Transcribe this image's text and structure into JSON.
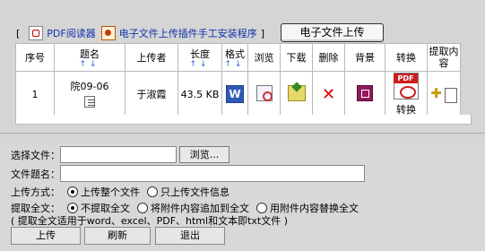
{
  "toolbar": {
    "bracket_open": "[",
    "pdf_reader_link": "PDF阅读器",
    "plugin_link": "电子文件上传插件手工安装程序",
    "bracket_close": "]",
    "upload_button": "电子文件上传"
  },
  "table": {
    "headers": [
      "序号",
      "题名",
      "上传者",
      "长度",
      "格式",
      "浏览",
      "下载",
      "删除",
      "背景",
      "转换",
      "提取内容"
    ],
    "sort_arrows": "↑↓",
    "row": {
      "index": "1",
      "title": "院09-06",
      "uploader": "于淑霞",
      "size": "43.5 KB",
      "format_icon": "word-doc-icon",
      "convert_label": "转换",
      "pdf_tag": "PDF",
      "pdf_sub": "Adobe"
    }
  },
  "form": {
    "select_file_label": "选择文件：",
    "browse_button": "浏览...",
    "file_title_label": "文件题名：",
    "upload_mode_label": "上传方式：",
    "upload_mode_options": [
      "上传整个文件",
      "只上传文件信息"
    ],
    "extract_label": "提取全文：",
    "extract_options": [
      "不提取全文",
      "将附件内容追加到全文",
      "用附件内容替换全文"
    ],
    "note": "( 提取全文适用于word、excel、PDF、html和文本即txt文件 )"
  },
  "actions": {
    "upload": "上传",
    "refresh": "刷新",
    "exit": "退出"
  }
}
